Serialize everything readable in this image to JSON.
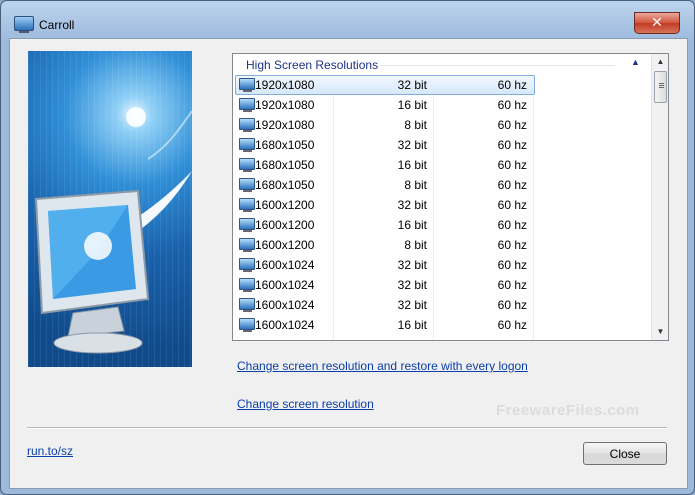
{
  "window": {
    "title": "Carroll",
    "close_glyph": "✕"
  },
  "list": {
    "group_title": "High Screen Resolutions",
    "collapse_glyph": "▲",
    "scroll_up_glyph": "▲",
    "scroll_down_glyph": "▼",
    "rows": [
      {
        "resolution": "1920x1080",
        "depth": "32 bit",
        "refresh": "60 hz",
        "selected": true
      },
      {
        "resolution": "1920x1080",
        "depth": "16 bit",
        "refresh": "60 hz"
      },
      {
        "resolution": "1920x1080",
        "depth": "8 bit",
        "refresh": "60 hz"
      },
      {
        "resolution": "1680x1050",
        "depth": "32 bit",
        "refresh": "60 hz"
      },
      {
        "resolution": "1680x1050",
        "depth": "16 bit",
        "refresh": "60 hz"
      },
      {
        "resolution": "1680x1050",
        "depth": "8 bit",
        "refresh": "60 hz"
      },
      {
        "resolution": "1600x1200",
        "depth": "32 bit",
        "refresh": "60 hz"
      },
      {
        "resolution": "1600x1200",
        "depth": "16 bit",
        "refresh": "60 hz"
      },
      {
        "resolution": "1600x1200",
        "depth": "8 bit",
        "refresh": "60 hz"
      },
      {
        "resolution": "1600x1024",
        "depth": "32 bit",
        "refresh": "60 hz"
      },
      {
        "resolution": "1600x1024",
        "depth": "32 bit",
        "refresh": "60 hz"
      },
      {
        "resolution": "1600x1024",
        "depth": "32 bit",
        "refresh": "60 hz"
      },
      {
        "resolution": "1600x1024",
        "depth": "16 bit",
        "refresh": "60 hz"
      }
    ]
  },
  "links": {
    "change_restore": "Change screen resolution and restore with every logon",
    "change": "Change screen resolution",
    "website": "run.to/sz"
  },
  "watermark": "FreewareFiles.com",
  "buttons": {
    "close": "Close"
  },
  "colors": {
    "link": "#0a3ea8",
    "group_header": "#1e3287",
    "selection": "#d6e8fb"
  }
}
